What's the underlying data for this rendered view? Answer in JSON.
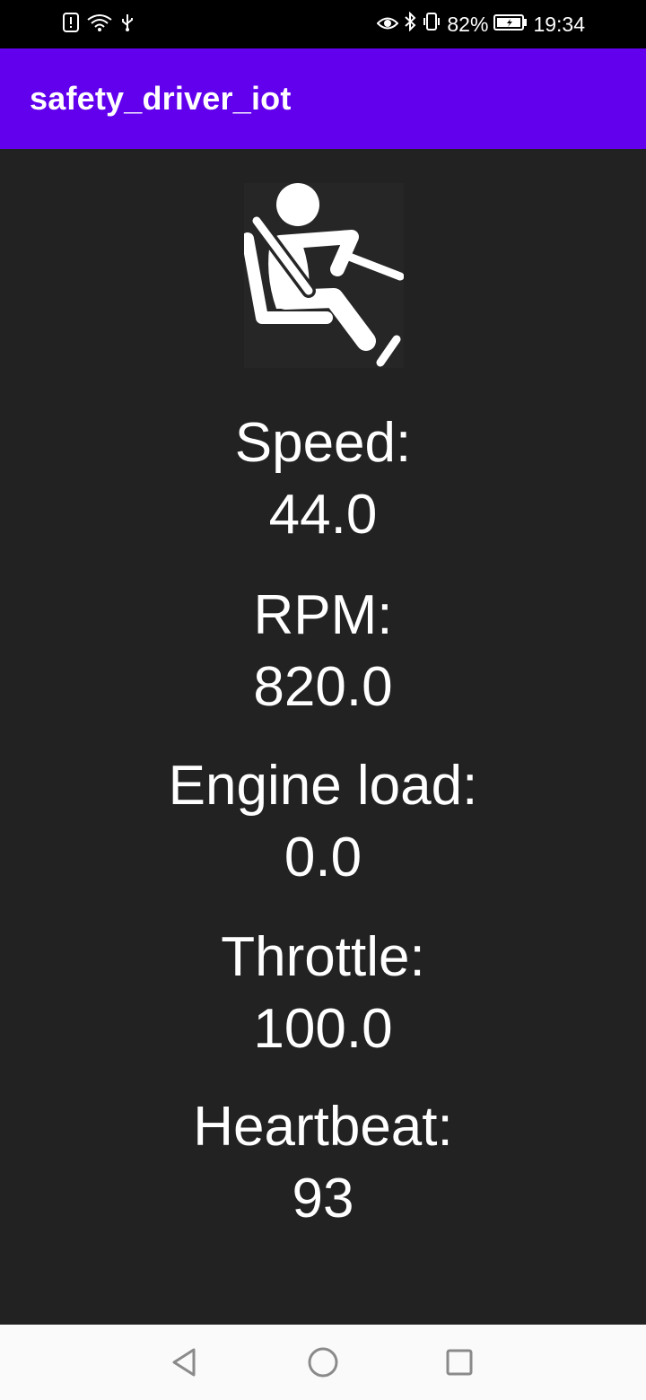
{
  "status_bar": {
    "battery_percent": "82%",
    "time": "19:34",
    "icons": [
      "alert-icon",
      "wifi-icon",
      "usb-icon",
      "eye-icon",
      "bluetooth-icon",
      "vibrate-icon",
      "battery-icon"
    ]
  },
  "app_bar": {
    "title": "safety_driver_iot",
    "color": "#6200ee"
  },
  "readings": [
    {
      "label": "Speed:",
      "value": "44.0"
    },
    {
      "label": "RPM:",
      "value": "820.0"
    },
    {
      "label": "Engine load:",
      "value": "0.0"
    },
    {
      "label": "Throttle:",
      "value": "100.0"
    },
    {
      "label": "Heartbeat:",
      "value": "93"
    }
  ],
  "nav_bar": {
    "buttons": [
      "back-icon",
      "home-icon",
      "recents-icon"
    ]
  }
}
